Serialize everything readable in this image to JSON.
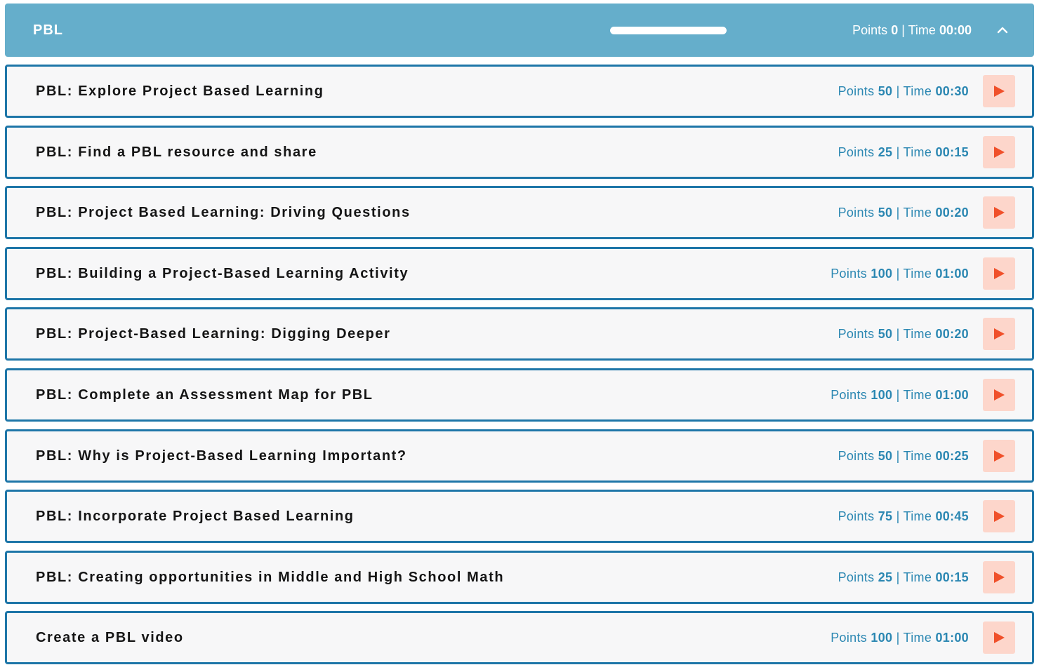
{
  "header": {
    "title": "PBL",
    "progress": 1.0,
    "points_label": "Points",
    "points_value": "0",
    "separator": "|",
    "time_label": "Time",
    "time_value": "00:00",
    "collapse_icon": "chevron-up-icon"
  },
  "items": [
    {
      "name": "PBL: Explore Project Based Learning",
      "points_label": "Points",
      "points": "50",
      "separator": "|",
      "time_label": "Time",
      "time": "00:30",
      "action_icon": "play-icon"
    },
    {
      "name": "PBL: Find a PBL resource and share",
      "points_label": "Points",
      "points": "25",
      "separator": "|",
      "time_label": "Time",
      "time": "00:15",
      "action_icon": "play-icon"
    },
    {
      "name": "PBL: Project Based Learning: Driving Questions",
      "points_label": "Points",
      "points": "50",
      "separator": "|",
      "time_label": "Time",
      "time": "00:20",
      "action_icon": "play-icon"
    },
    {
      "name": "PBL: Building a Project-Based Learning Activity",
      "points_label": "Points",
      "points": "100",
      "separator": "|",
      "time_label": "Time",
      "time": "01:00",
      "action_icon": "play-icon"
    },
    {
      "name": "PBL: Project-Based Learning: Digging Deeper",
      "points_label": "Points",
      "points": "50",
      "separator": "|",
      "time_label": "Time",
      "time": "00:20",
      "action_icon": "play-icon"
    },
    {
      "name": "PBL: Complete an Assessment Map for PBL",
      "points_label": "Points",
      "points": "100",
      "separator": "|",
      "time_label": "Time",
      "time": "01:00",
      "action_icon": "play-icon"
    },
    {
      "name": "PBL: Why is Project-Based Learning Important?",
      "points_label": "Points",
      "points": "50",
      "separator": "|",
      "time_label": "Time",
      "time": "00:25",
      "action_icon": "play-icon"
    },
    {
      "name": "PBL: Incorporate Project Based Learning",
      "points_label": "Points",
      "points": "75",
      "separator": "|",
      "time_label": "Time",
      "time": "00:45",
      "action_icon": "play-icon"
    },
    {
      "name": "PBL: Creating opportunities in Middle and High School Math",
      "points_label": "Points",
      "points": "25",
      "separator": "|",
      "time_label": "Time",
      "time": "00:15",
      "action_icon": "play-icon"
    },
    {
      "name": "Create a PBL video",
      "points_label": "Points",
      "points": "100",
      "separator": "|",
      "time_label": "Time",
      "time": "01:00",
      "action_icon": "play-icon"
    }
  ],
  "colors": {
    "header_bg": "#65aecb",
    "item_border": "#1e76a8",
    "item_bg": "#f7f7f8",
    "meta_text": "#2b87b2",
    "play_bg": "#fdd6cb",
    "play_icon": "#f0502a"
  }
}
